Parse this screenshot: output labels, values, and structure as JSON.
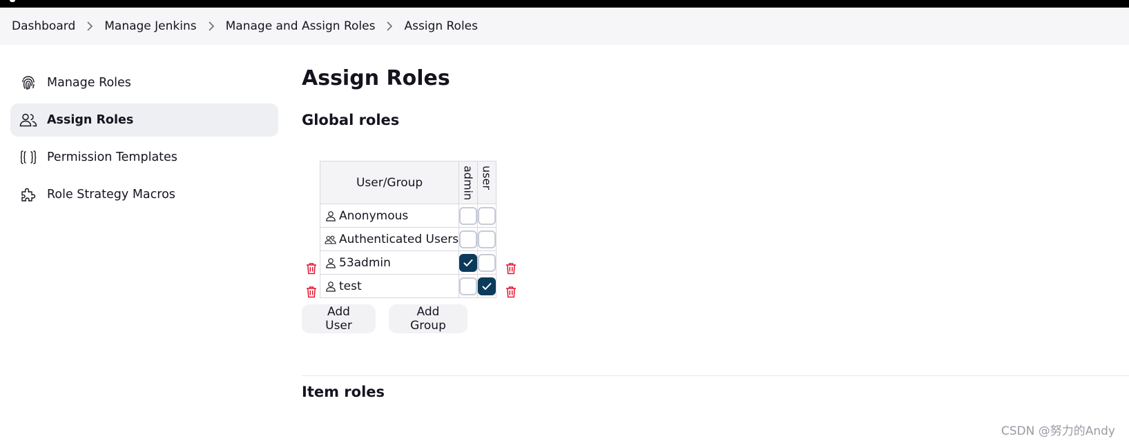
{
  "breadcrumb": [
    "Dashboard",
    "Manage Jenkins",
    "Manage and Assign Roles",
    "Assign Roles"
  ],
  "sidebar": {
    "items": [
      {
        "label": "Manage Roles",
        "icon": "fingerprint-icon",
        "active": false
      },
      {
        "label": "Assign Roles",
        "icon": "users-icon",
        "active": true
      },
      {
        "label": "Permission Templates",
        "icon": "braces-icon",
        "active": false
      },
      {
        "label": "Role Strategy Macros",
        "icon": "puzzle-icon",
        "active": false
      }
    ]
  },
  "main": {
    "title": "Assign Roles",
    "global_roles": {
      "section_title": "Global roles",
      "user_group_header": "User/Group",
      "role_columns": [
        "admin",
        "user"
      ],
      "rows": [
        {
          "name": "Anonymous",
          "icon": "user-icon",
          "deletable": false,
          "checks": [
            false,
            false
          ]
        },
        {
          "name": "Authenticated Users",
          "icon": "group-icon",
          "deletable": false,
          "checks": [
            false,
            false
          ]
        },
        {
          "name": "53admin",
          "icon": "user-icon",
          "deletable": true,
          "checks": [
            true,
            false
          ]
        },
        {
          "name": "test",
          "icon": "user-icon",
          "deletable": true,
          "checks": [
            false,
            true
          ]
        }
      ],
      "add_user_label": "Add User",
      "add_group_label": "Add Group"
    },
    "item_roles": {
      "section_title": "Item roles"
    }
  },
  "watermark": "CSDN @努力的Andy",
  "colors": {
    "accent": "#0c3a5a",
    "delete": "#e6142d",
    "sidebar_active_bg": "#eeeff3",
    "breadcrumb_bg": "#f6f6f8"
  }
}
